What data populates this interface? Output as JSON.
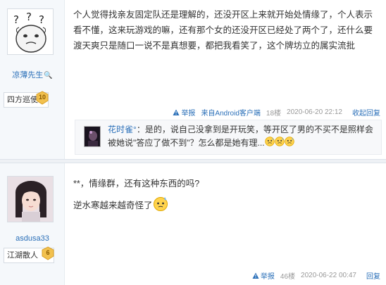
{
  "posts": [
    {
      "author": {
        "name": "凉薄先生",
        "rank_title": "四方巡使",
        "level": "10"
      },
      "body": "个人觉得找亲友固定队还是理解的，还没开区上来就开始处情缘了，个人表示看不懂，这来玩游戏的嘛，还有那个女的还没开区已经处了两个了，还什么要渡天爽只是随口一说不是真想要，都把我看笑了，这个牌坊立的属实流批",
      "meta": {
        "report": "举报",
        "client": "来自Android客户端",
        "floor": "18楼",
        "datetime": "2020-06-20 22:12",
        "reply": "收起回复"
      },
      "comment": {
        "author": "花时雀°",
        "text": "：是的，说自己没拿到是开玩笑，等开区了男的不买不是照样会被她说\"答应了做不到\"？怎么都是她有理..."
      }
    },
    {
      "author": {
        "name": "asdusa33",
        "rank_title": "江湖散人",
        "level": "6"
      },
      "lines": [
        "**，情缘群，还有这种东西的吗?",
        "逆水寒越来越奇怪了"
      ],
      "meta": {
        "report": "举报",
        "floor": "46楼",
        "datetime": "2020-06-22 00:47",
        "reply": "回复"
      }
    }
  ],
  "colors": {
    "link": "#2a6fb8",
    "meta_gray": "#999999",
    "sidebar_bg": "#f5f8fb",
    "badge_gold": "#f2c14e"
  },
  "icons": [
    "meme-avatar",
    "key-icon",
    "level-badge",
    "report-icon",
    "sweat-emoji",
    "confused-emoji",
    "girl-photo-avatar",
    "dark-avatar"
  ]
}
